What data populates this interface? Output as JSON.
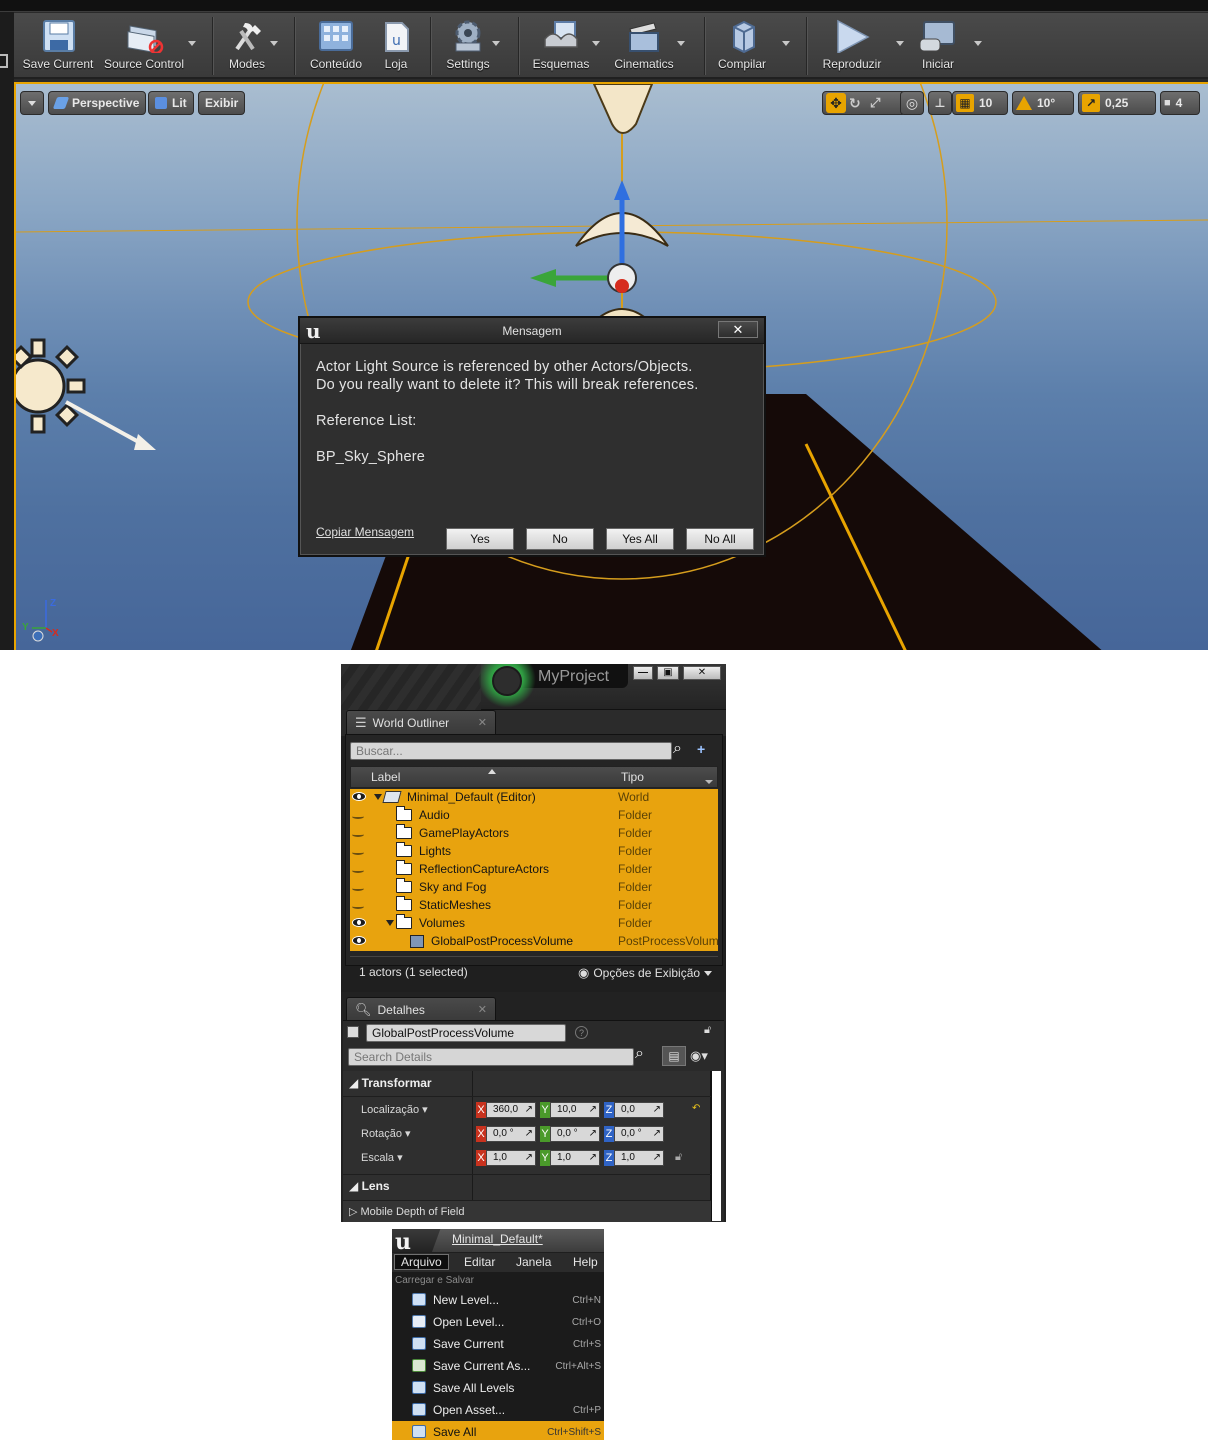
{
  "toolbar": {
    "buttons": [
      {
        "label": "Save Current",
        "icon": "save-icon"
      },
      {
        "label": "Source Control",
        "icon": "source-control-icon"
      },
      {
        "label": "Modes",
        "icon": "modes-icon"
      },
      {
        "label": "Conteúdo",
        "icon": "content-icon"
      },
      {
        "label": "Loja",
        "icon": "marketplace-icon"
      },
      {
        "label": "Settings",
        "icon": "settings-icon"
      },
      {
        "label": "Esquemas",
        "icon": "blueprints-icon"
      },
      {
        "label": "Cinematics",
        "icon": "cinematics-icon"
      },
      {
        "label": "Compilar",
        "icon": "build-icon"
      },
      {
        "label": "Reproduzir",
        "icon": "play-icon"
      },
      {
        "label": "Iniciar",
        "icon": "launch-icon"
      }
    ]
  },
  "viewport": {
    "perspective": "Perspective",
    "lit": "Lit",
    "show": "Exibir",
    "grid_snap": "10",
    "rotation_snap": "10°",
    "scale_snap": "0,25",
    "camera_speed": "4",
    "axis_labels": {
      "z": "Z",
      "y": "Y",
      "x": "X"
    }
  },
  "dialog": {
    "title": "Mensagem",
    "line1": "Actor Light Source is referenced by other Actors/Objects.",
    "line2": "Do you really want to delete it? This will break references.",
    "ref_heading": "Reference List:",
    "ref_item": "BP_Sky_Sphere",
    "copy_link": "Copiar Mensagem",
    "buttons": {
      "yes": "Yes",
      "no": "No",
      "yes_all": "Yes All",
      "no_all": "No All"
    }
  },
  "outliner": {
    "project_name": "MyProject",
    "tab_title": "World Outliner",
    "search_placeholder": "Buscar...",
    "col_label": "Label",
    "col_type": "Tipo",
    "rows": [
      {
        "label": "Minimal_Default (Editor)",
        "type": "World"
      },
      {
        "label": "Audio",
        "type": "Folder"
      },
      {
        "label": "GamePlayActors",
        "type": "Folder"
      },
      {
        "label": "Lights",
        "type": "Folder"
      },
      {
        "label": "ReflectionCaptureActors",
        "type": "Folder"
      },
      {
        "label": "Sky and Fog",
        "type": "Folder"
      },
      {
        "label": "StaticMeshes",
        "type": "Folder"
      },
      {
        "label": "Volumes",
        "type": "Folder"
      },
      {
        "label": "GlobalPostProcessVolume",
        "type": "PostProcessVolum"
      }
    ],
    "status": "1 actors (1 selected)",
    "view_options": "Opções de Exibição"
  },
  "details": {
    "tab_title": "Detalhes",
    "object_name": "GlobalPostProcessVolume",
    "search_placeholder": "Search Details",
    "section_transform": "Transformar",
    "location_label": "Localização",
    "rotation_label": "Rotação",
    "scale_label": "Escala",
    "location": {
      "x": "360,0",
      "y": "10,0",
      "z": "0,0"
    },
    "rotation": {
      "x": "0,0 °",
      "y": "0,0 °",
      "z": "0,0 °"
    },
    "scale": {
      "x": "1,0",
      "y": "1,0",
      "z": "1,0"
    },
    "section_lens": "Lens",
    "sub_mobile_dof": "Mobile Depth of Field"
  },
  "filemenu": {
    "window_title": "Minimal_Default*",
    "menus": [
      "Arquivo",
      "Editar",
      "Janela",
      "Help"
    ],
    "section": "Carregar e Salvar",
    "items": [
      {
        "label": "New Level...",
        "shortcut": "Ctrl+N"
      },
      {
        "label": "Open Level...",
        "shortcut": "Ctrl+O"
      },
      {
        "label": "Save Current",
        "shortcut": "Ctrl+S"
      },
      {
        "label": "Save Current As...",
        "shortcut": "Ctrl+Alt+S"
      },
      {
        "label": "Save All Levels",
        "shortcut": ""
      },
      {
        "label": "Open Asset...",
        "shortcut": "Ctrl+P"
      },
      {
        "label": "Save All",
        "shortcut": "Ctrl+Shift+S"
      }
    ]
  },
  "colors": {
    "selection": "#e8a30e",
    "viewport_border": "#e8a400"
  }
}
